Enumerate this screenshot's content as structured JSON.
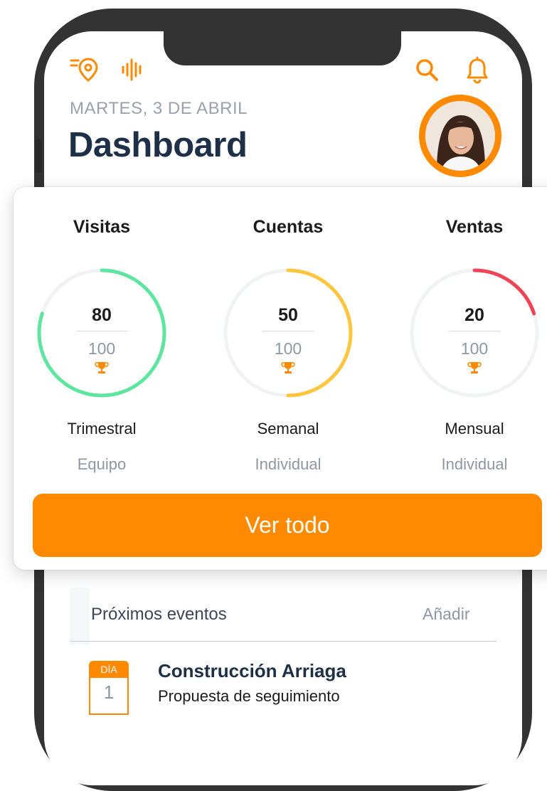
{
  "header": {
    "date": "MARTES, 3 DE ABRIL",
    "title": "Dashboard"
  },
  "icons": {
    "left": [
      "location-pin-icon",
      "audio-wave-icon"
    ],
    "right": [
      "search-icon",
      "bell-icon"
    ],
    "accent": "#ff8a00"
  },
  "stats": [
    {
      "title": "Visitas",
      "value": "80",
      "total": "100",
      "progress": 0.8,
      "color": "#5ee6a0",
      "period": "Trimestral",
      "scope": "Equipo"
    },
    {
      "title": "Cuentas",
      "value": "50",
      "total": "100",
      "progress": 0.5,
      "color": "#ffc53d",
      "period": "Semanal",
      "scope": "Individual"
    },
    {
      "title": "Ventas",
      "value": "20",
      "total": "100",
      "progress": 0.2,
      "color": "#ee4455",
      "period": "Mensual",
      "scope": "Individual"
    }
  ],
  "cta": {
    "label": "Ver todo"
  },
  "events": {
    "title": "Próximos eventos",
    "add_label": "Añadir",
    "items": [
      {
        "day_label": "DÍA",
        "day_number": "1",
        "name": "Construcción Arriaga",
        "subtitle": "Propuesta de seguimiento"
      }
    ]
  },
  "colors": {
    "title": "#1e3048",
    "muted": "#8e97a2"
  }
}
